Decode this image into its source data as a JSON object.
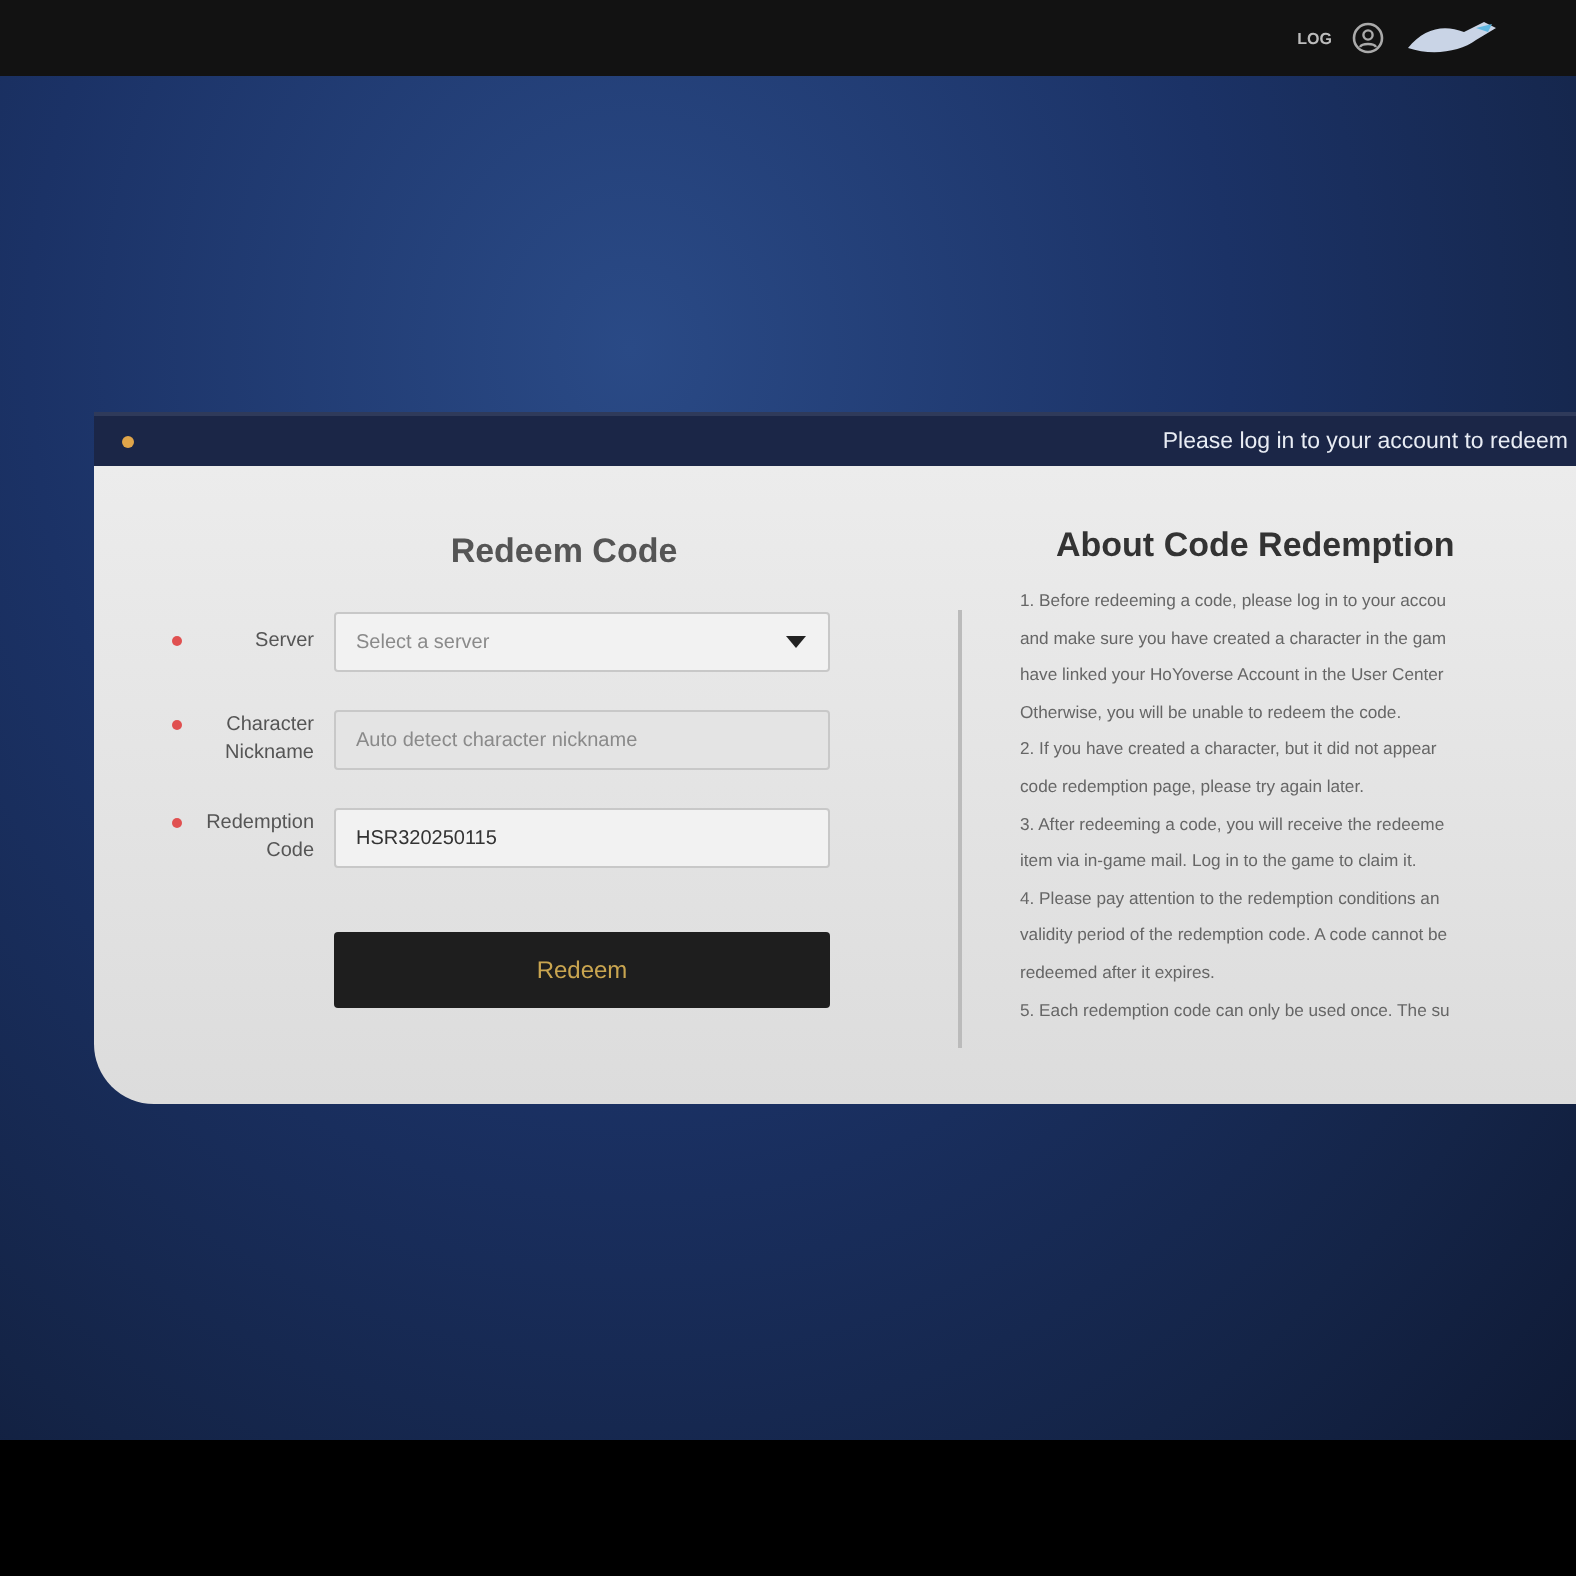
{
  "top_bar": {
    "link": "LOG"
  },
  "banner": {
    "text": "Please log in to your account to redeem"
  },
  "redeem_form": {
    "title": "Redeem Code",
    "fields": [
      {
        "kind": "select",
        "label": "Server",
        "required": true,
        "placeholder": "Select a server",
        "disabled": false
      },
      {
        "kind": "text",
        "label": "Character Nickname",
        "required": true,
        "placeholder": "Auto detect character nickname",
        "disabled": true
      },
      {
        "kind": "text",
        "label": "Redemption Code",
        "required": true,
        "value": "HSR320250115",
        "disabled": false
      }
    ],
    "submit": "Redeem"
  },
  "about": {
    "title": "About Code Redemption",
    "lines": [
      "1. Before redeeming a code, please log in to your accou",
      "and make sure you have created a character in the gam",
      "have linked your HoYoverse Account in the User Center",
      "Otherwise, you will be unable to redeem the code.",
      "2. If you have created a character, but it did not appear",
      "code redemption page, please try again later.",
      "3. After redeeming a code, you will receive the redeeme",
      "item via in-game mail. Log in to the game to claim it.",
      "4. Please pay attention to the redemption conditions an",
      "validity period of the redemption code. A code cannot be",
      "redeemed after it expires.",
      "5. Each redemption code can only be used once. The su"
    ]
  }
}
